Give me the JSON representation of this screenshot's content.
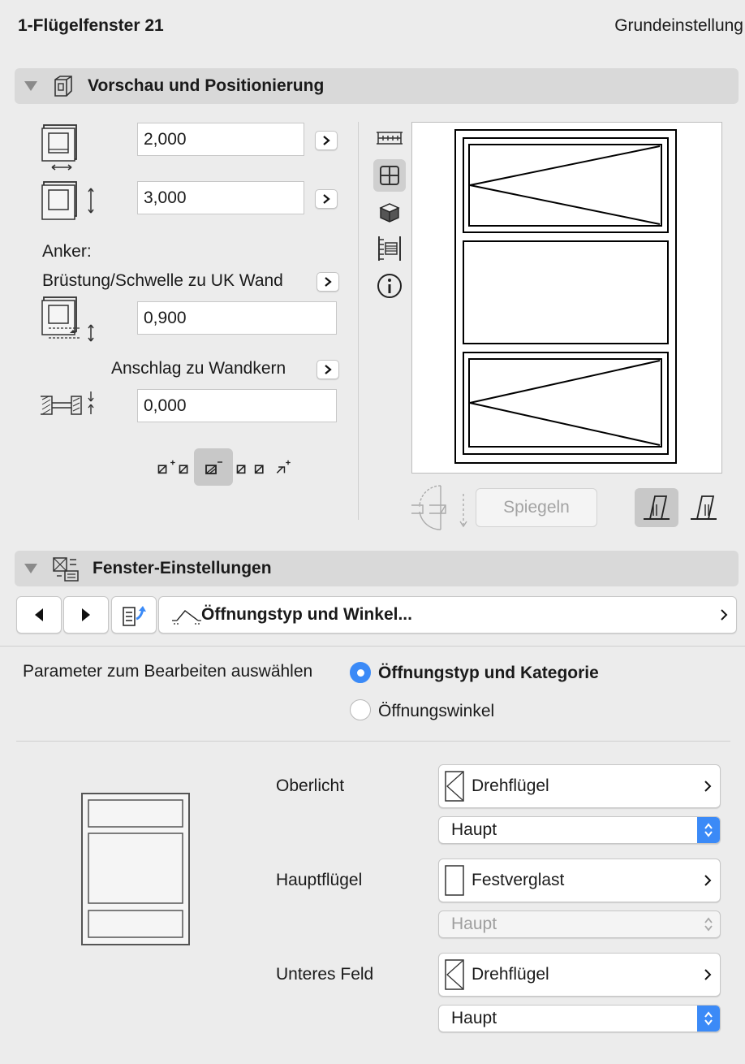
{
  "header": {
    "title": "1-Flügelfenster 21",
    "preset": "Grundeinstellung"
  },
  "section1": {
    "title": "Vorschau und Positionierung"
  },
  "width": {
    "value": "2,000"
  },
  "height": {
    "value": "3,000"
  },
  "anchor": {
    "label": "Anker:",
    "sill_label": "Brüstung/Schwelle zu UK Wand",
    "sill_value": "0,900"
  },
  "reveal": {
    "label": "Anschlag zu Wandkern",
    "value": "0,000"
  },
  "mirror_button": "Spiegeln",
  "section2": {
    "title": "Fenster-Einstellungen"
  },
  "page_nav": {
    "current_page": "Öffnungstyp und Winkel..."
  },
  "params": {
    "prompt": "Parameter zum Bearbeiten auswählen",
    "options": [
      "Öffnungstyp und Kategorie",
      "Öffnungswinkel"
    ],
    "selected": "Öffnungstyp und Kategorie"
  },
  "panels": [
    {
      "label": "Oberlicht",
      "type": "Drehflügel",
      "category": "Haupt",
      "enabled": true
    },
    {
      "label": "Hauptflügel",
      "type": "Festverglast",
      "category": "Haupt",
      "enabled": false
    },
    {
      "label": "Unteres Feld",
      "type": "Drehflügel",
      "category": "Haupt",
      "enabled": true
    }
  ],
  "colors": {
    "accent": "#3b8af7",
    "section_bar": "#d9d9d9",
    "background": "#ececec"
  }
}
